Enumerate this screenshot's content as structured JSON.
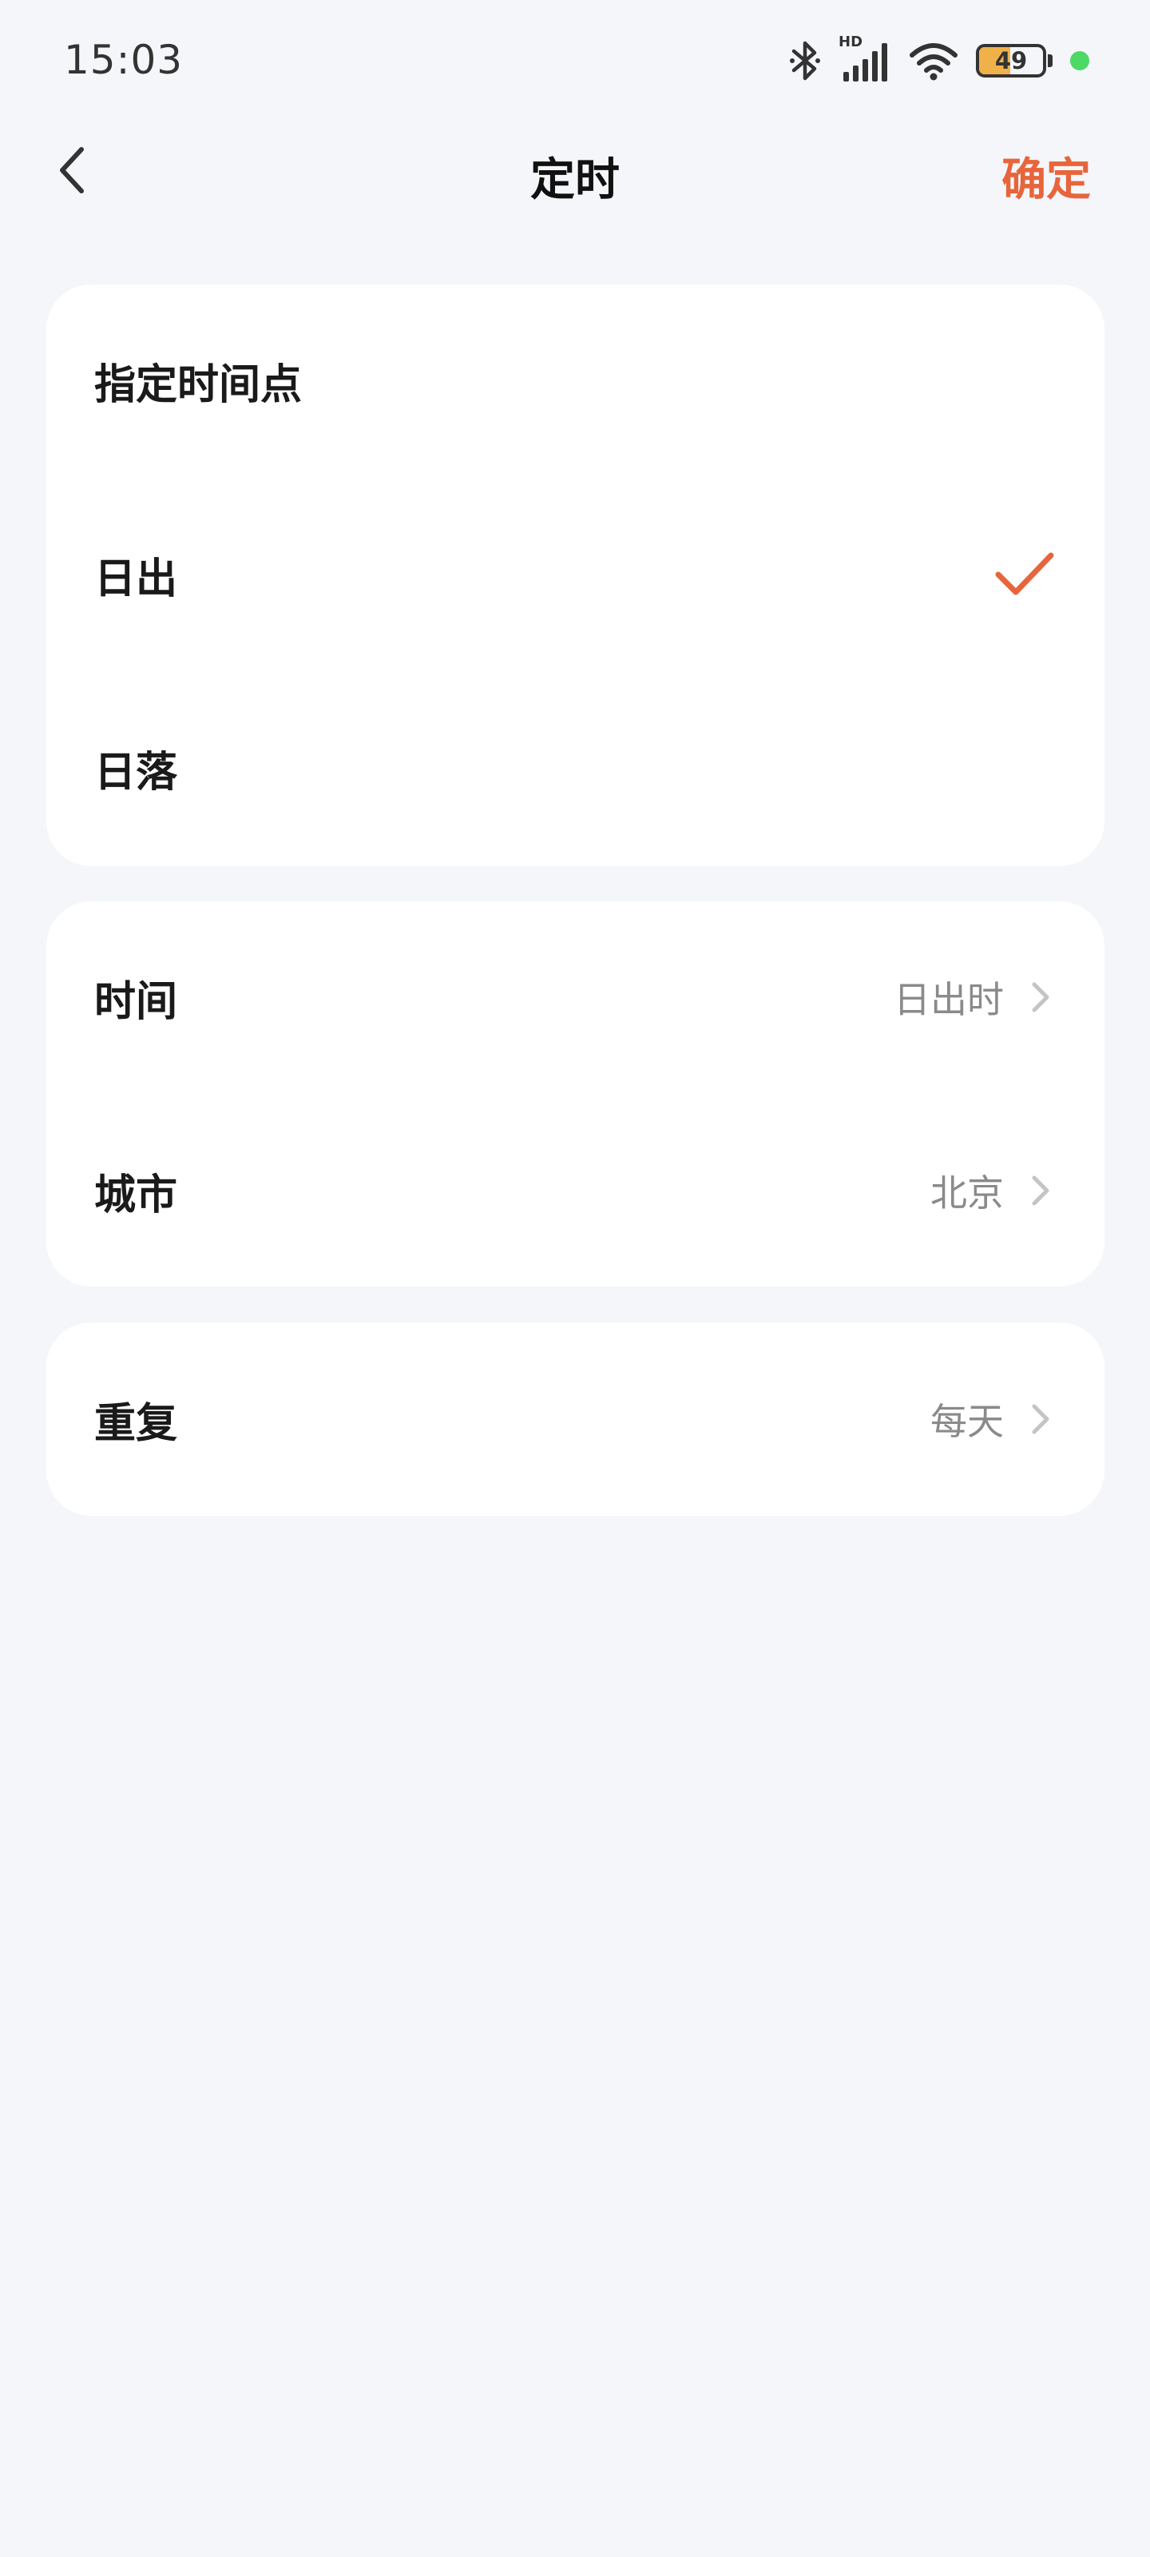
{
  "status_bar": {
    "time": "15:03",
    "hd_label": "HD",
    "battery_level": "49",
    "icons": [
      "bluetooth-icon",
      "signal-icon",
      "wifi-icon",
      "battery-icon",
      "active-dot"
    ],
    "battery_fraction": 0.49
  },
  "nav": {
    "title": "定时",
    "confirm_label": "确定",
    "back_icon": "chevron-left-icon"
  },
  "schedule_type": {
    "header": "指定时间点",
    "options": [
      {
        "label": "日出",
        "selected": true
      },
      {
        "label": "日落",
        "selected": false
      }
    ]
  },
  "settings": {
    "time": {
      "label": "时间",
      "value": "日出时"
    },
    "city": {
      "label": "城市",
      "value": "北京"
    }
  },
  "repeat": {
    "label": "重复",
    "value": "每天"
  },
  "colors": {
    "accent": "#e8643b",
    "background": "#f4f6fa",
    "card": "#ffffff",
    "secondary_text": "#8a8a8a",
    "chevron": "#c4c4c4",
    "active_dot": "#4cd964",
    "battery_fill": "#f0b14b"
  }
}
